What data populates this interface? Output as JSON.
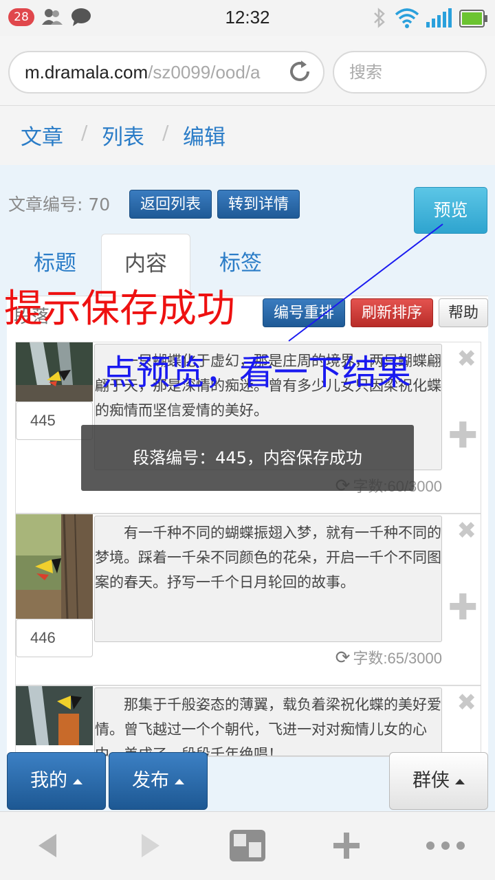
{
  "status_bar": {
    "notification_count": "28",
    "time": "12:32"
  },
  "browser": {
    "url_host": "m.dramala.com",
    "url_path": "/sz0099/ood/a",
    "search_placeholder": "搜索"
  },
  "breadcrumb": {
    "items": [
      "文章",
      "列表",
      "编辑"
    ],
    "separator": "/"
  },
  "article": {
    "number_label": "文章编号: 70",
    "back_button": "返回列表",
    "detail_button": "转到详情",
    "preview_button": "预览"
  },
  "tabs": [
    {
      "label": "标题",
      "active": false
    },
    {
      "label": "内容",
      "active": true
    },
    {
      "label": "标签",
      "active": false
    }
  ],
  "toolbar": {
    "partial_label": "段落",
    "renumber_button": "编号重排",
    "refresh_button": "刷新排序",
    "help_button": "帮助"
  },
  "paragraphs": [
    {
      "number": "445",
      "text": "一只蝴蝶化于虚幻，那是庄周的境界，两只蝴蝶翩翩于天，那是深情的痴迷。曾有多少儿女只因梁祝化蝶的痴情而坚信爱情的美好。",
      "count": "字数:60/3000"
    },
    {
      "number": "446",
      "text": "有一千种不同的蝴蝶振翅入梦，就有一千种不同的梦境。踩着一千朵不同颜色的花朵，开启一千个不同图案的春天。抒写一千个日月轮回的故事。",
      "count": "字数:65/3000"
    },
    {
      "number": "",
      "text": "那集于千般姿态的薄翼，载负着梁祝化蝶的美好爱情。曾飞越过一个个朝代，飞进一对对痴情儿女的心中，美成了一段段千年绝唱！",
      "count": ""
    }
  ],
  "toast": "段落编号：445，内容保存成功",
  "annotations": {
    "red": "提示保存成功",
    "blue": "点预览，看一下结果"
  },
  "bottom_nav": {
    "mine": "我的",
    "publish": "发布",
    "group": "群侠"
  },
  "colors": {
    "link_blue": "#2a7cc7",
    "primary_dark": "#1f5a96",
    "preview_cyan": "#2ea4cf",
    "danger_red": "#b82c28",
    "annotation_red": "#ee1111",
    "annotation_blue": "#1a1af0"
  }
}
